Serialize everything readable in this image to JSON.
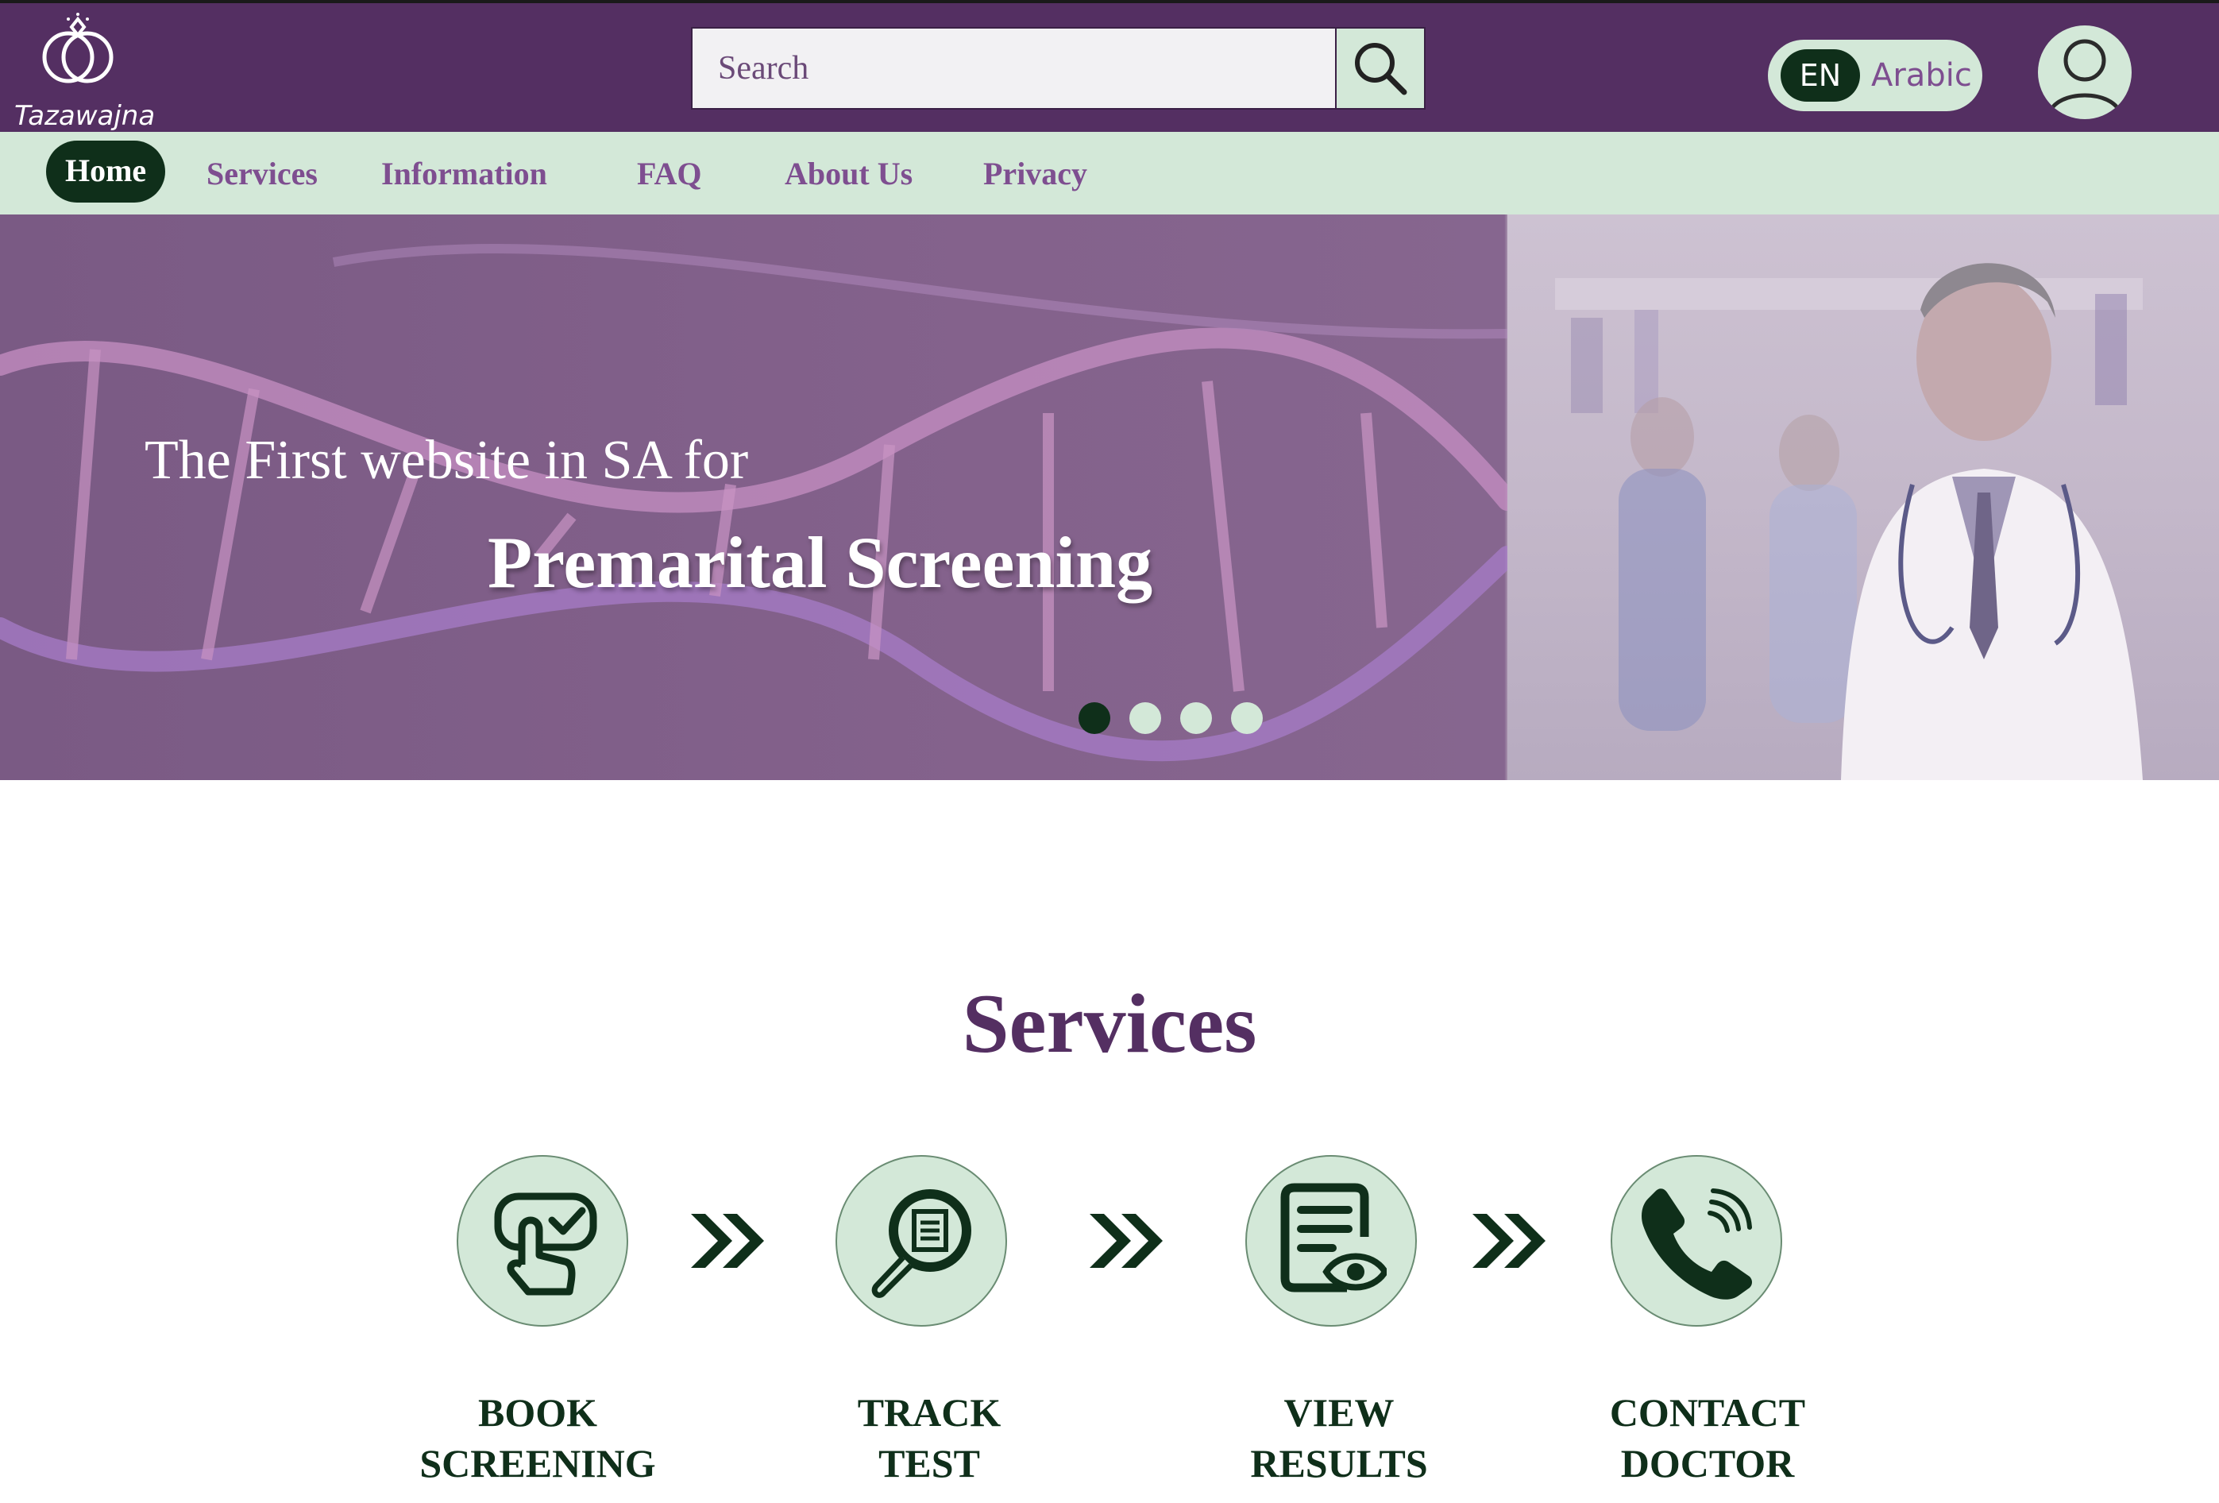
{
  "header": {
    "logo_text": "Tazawajna",
    "search": {
      "placeholder": "Search"
    },
    "language": {
      "active": "EN",
      "alternate": "Arabic"
    }
  },
  "nav": {
    "items": [
      {
        "label": "Home"
      },
      {
        "label": "Services"
      },
      {
        "label": "Information"
      },
      {
        "label": "FAQ"
      },
      {
        "label": "About Us"
      },
      {
        "label": "Privacy"
      }
    ]
  },
  "hero": {
    "line1": "The First website in SA for",
    "line2": "Premarital Screening",
    "slides_total": 4,
    "active_slide": 1
  },
  "services": {
    "title": "Services",
    "items": [
      {
        "label": "BOOK\nSCREENING",
        "icon": "touch-check-icon"
      },
      {
        "label": "TRACK\nTEST",
        "icon": "magnifier-document-icon"
      },
      {
        "label": "VIEW\nRESULTS",
        "icon": "document-eye-icon"
      },
      {
        "label": "CONTACT\nDOCTOR",
        "icon": "phone-icon"
      }
    ]
  },
  "colors": {
    "brand_purple": "#542f62",
    "mint": "#d3e8d8",
    "dark_green": "#0f2f1a",
    "link_purple": "#7e4e90"
  }
}
